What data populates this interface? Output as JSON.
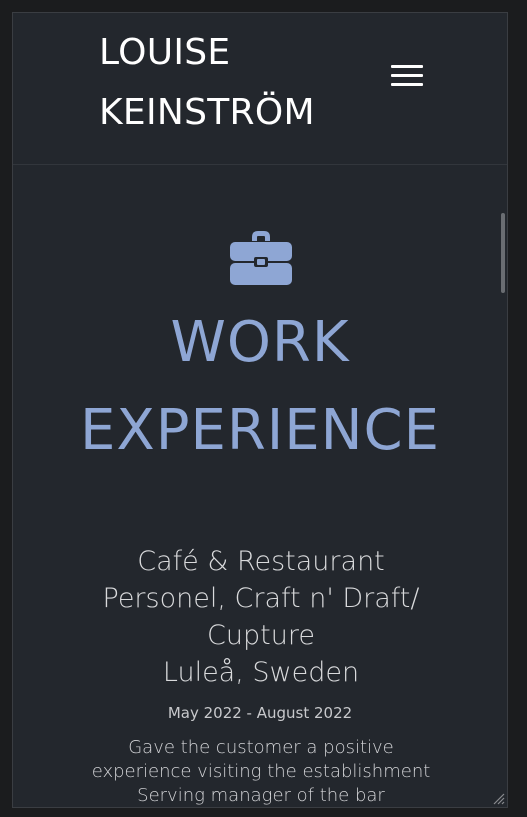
{
  "header": {
    "brand_line1": "LOUISE",
    "brand_line2": "KEINSTRÖM",
    "menu_icon": "hamburger-menu-icon"
  },
  "section": {
    "icon": "briefcase-icon",
    "title_line1": "WORK",
    "title_line2": "EXPERIENCE",
    "accent_color": "#8ea6d4"
  },
  "job": {
    "title_lines": [
      "Café & Restaurant",
      "Personel, Craft n' Draft/",
      "Cupture",
      "Luleå, Sweden"
    ],
    "dates": "May 2022 - August 2022",
    "description_lines": [
      "Gave the customer a positive",
      "experience visiting the establishment",
      "Serving manager of the bar"
    ]
  },
  "colors": {
    "background": "#23272d",
    "text": "#ffffff"
  }
}
